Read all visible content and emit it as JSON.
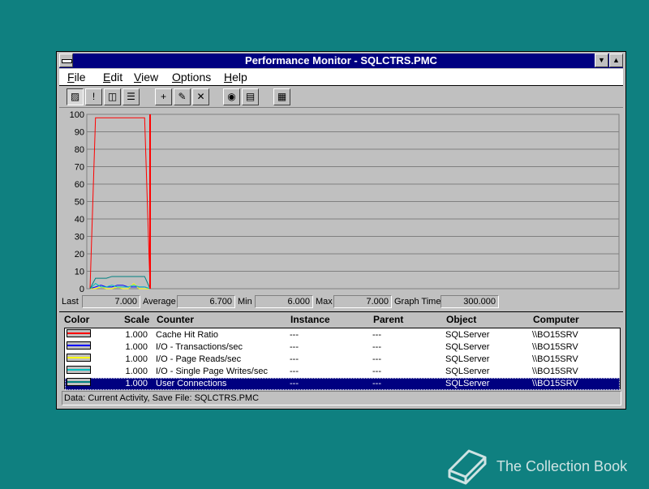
{
  "window": {
    "title": "Performance Monitor - SQLCTRS.PMC"
  },
  "menu": [
    {
      "label": "File",
      "key": "F",
      "rest": "ile"
    },
    {
      "label": "Edit",
      "key": "E",
      "rest": "dit"
    },
    {
      "label": "View",
      "key": "V",
      "rest": "iew"
    },
    {
      "label": "Options",
      "key": "O",
      "rest": "ptions"
    },
    {
      "label": "Help",
      "key": "H",
      "rest": "elp"
    }
  ],
  "toolbar": [
    {
      "icon": "chart-view-icon",
      "glyph": "▨",
      "pressed": true
    },
    {
      "icon": "alert-view-icon",
      "glyph": "!"
    },
    {
      "icon": "log-view-icon",
      "glyph": "◫"
    },
    {
      "icon": "report-view-icon",
      "glyph": "☰"
    },
    {
      "icon": "add-counter-icon",
      "glyph": "+"
    },
    {
      "icon": "edit-counter-icon",
      "glyph": "✎"
    },
    {
      "icon": "delete-counter-icon",
      "glyph": "✕"
    },
    {
      "icon": "snapshot-icon",
      "glyph": "◉"
    },
    {
      "icon": "bookmark-icon",
      "glyph": "▤"
    },
    {
      "icon": "options-icon",
      "glyph": "▦"
    }
  ],
  "stats": {
    "last_label": "Last",
    "last": "7.000",
    "average_label": "Average",
    "average": "6.700",
    "min_label": "Min",
    "min": "6.000",
    "max_label": "Max",
    "max": "7.000",
    "graph_time_label": "Graph Time",
    "graph_time": "300.000"
  },
  "legend": {
    "headers": {
      "color": "Color",
      "scale": "Scale",
      "counter": "Counter",
      "instance": "Instance",
      "parent": "Parent",
      "object": "Object",
      "computer": "Computer"
    },
    "rows": [
      {
        "color": "#ff0000",
        "scale": "1.000",
        "counter": "Cache Hit Ratio",
        "instance": "---",
        "parent": "---",
        "object": "SQLServer",
        "computer": "\\\\BO15SRV"
      },
      {
        "color": "#0000ff",
        "scale": "1.000",
        "counter": "I/O - Transactions/sec",
        "instance": "---",
        "parent": "---",
        "object": "SQLServer",
        "computer": "\\\\BO15SRV"
      },
      {
        "color": "#ffff00",
        "scale": "1.000",
        "counter": "I/O - Page Reads/sec",
        "instance": "---",
        "parent": "---",
        "object": "SQLServer",
        "computer": "\\\\BO15SRV"
      },
      {
        "color": "#00c0c0",
        "scale": "1.000",
        "counter": "I/O - Single Page Writes/sec",
        "instance": "---",
        "parent": "---",
        "object": "SQLServer",
        "computer": "\\\\BO15SRV"
      },
      {
        "color": "#008080",
        "scale": "1.000",
        "counter": "User Connections",
        "instance": "---",
        "parent": "---",
        "object": "SQLServer",
        "computer": "\\\\BO15SRV"
      }
    ]
  },
  "status": {
    "text": "Data: Current Activity, Save File: SQLCTRS.PMC"
  },
  "brand": {
    "text": "The Collection Book"
  },
  "chart_data": {
    "type": "line",
    "ylim": [
      0,
      100
    ],
    "yticks": [
      "100",
      "90",
      "80",
      "70",
      "60",
      "50",
      "40",
      "30",
      "20",
      "10",
      "0"
    ],
    "grid": true,
    "x": [
      0,
      1,
      2,
      3,
      4,
      5,
      6,
      7,
      8,
      9,
      10,
      11
    ],
    "xlim": [
      0,
      300
    ],
    "series": [
      {
        "name": "Cache Hit Ratio",
        "color": "#ff0000",
        "values": [
          0,
          98,
          98,
          98,
          98,
          98,
          98,
          98,
          98,
          98,
          98,
          0
        ]
      },
      {
        "name": "I/O - Transactions/sec",
        "color": "#0000ff",
        "values": [
          0,
          1,
          2,
          1,
          1,
          2,
          2,
          1,
          1,
          1,
          1,
          0
        ]
      },
      {
        "name": "I/O - Page Reads/sec",
        "color": "#ffff00",
        "values": [
          0,
          0,
          1,
          0,
          0,
          1,
          0,
          0,
          3,
          0,
          0,
          0
        ]
      },
      {
        "name": "I/O - Single Page Writes/sec",
        "color": "#00c0c0",
        "values": [
          0,
          3,
          1,
          1,
          2,
          1,
          1,
          1,
          2,
          1,
          1,
          0
        ]
      },
      {
        "name": "User Connections",
        "color": "#008080",
        "values": [
          0,
          6,
          6,
          6,
          7,
          7,
          7,
          7,
          7,
          7,
          7,
          0
        ]
      }
    ]
  }
}
